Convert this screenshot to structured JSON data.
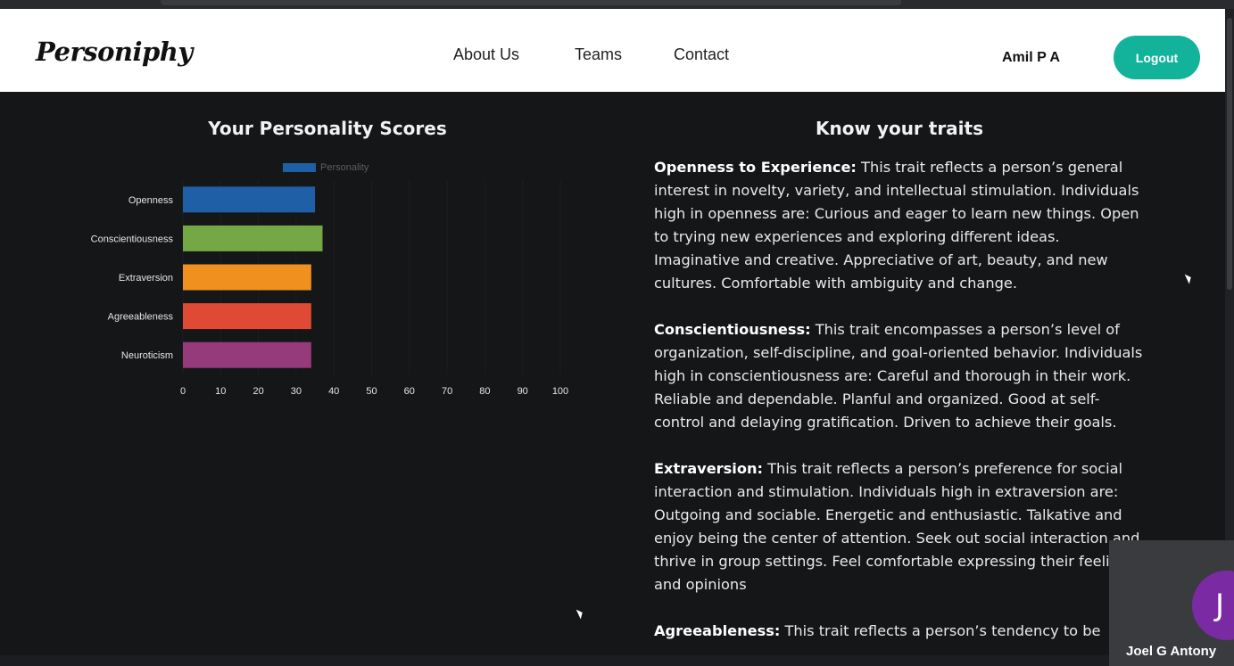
{
  "brand": {
    "logo_text": "Personiphy"
  },
  "nav": {
    "about": "About Us",
    "teams": "Teams",
    "contact": "Contact"
  },
  "user": {
    "name": "Amil P A",
    "logout_label": "Logout"
  },
  "chart_section": {
    "title": "Your Personality Scores"
  },
  "chart_data": {
    "type": "bar",
    "orientation": "horizontal",
    "title": "Your Personality Scores",
    "categories": [
      "Openness",
      "Conscientiousness",
      "Extraversion",
      "Agreeableness",
      "Neuroticism"
    ],
    "series": [
      {
        "name": "Personality",
        "values": [
          35,
          37,
          34,
          34,
          34
        ]
      }
    ],
    "colors": [
      "#1f5fa6",
      "#74a844",
      "#f0901e",
      "#e04a35",
      "#953a7a"
    ],
    "legend_color": "#1f5fa6",
    "xlim": [
      0,
      100
    ],
    "xticks": [
      "0",
      "10",
      "20",
      "30",
      "40",
      "50",
      "60",
      "70",
      "80",
      "90",
      "100"
    ],
    "legend": "top",
    "grid": true
  },
  "traits_section": {
    "title": "Know your traits",
    "items": [
      {
        "name": "Openness to Experience:",
        "text": " This trait reflects a person’s general interest in novelty, variety, and intellectual stimulation. Individuals high in openness are: Curious and eager to learn new things. Open to trying new experiences and exploring different ideas. Imaginative and creative. Appreciative of art, beauty, and new cultures. Comfortable with ambiguity and change."
      },
      {
        "name": "Conscientiousness:",
        "text": " This trait encompasses a person’s level of organization, self-discipline, and goal-oriented behavior. Individuals high in conscientiousness are: Careful and thorough in their work. Reliable and dependable. Planful and organized. Good at self-control and delaying gratification. Driven to achieve their goals."
      },
      {
        "name": "Extraversion:",
        "text": " This trait reflects a person’s preference for social interaction and stimulation. Individuals high in extraversion are: Outgoing and sociable. Energetic and enthusiastic. Talkative and enjoy being the center of attention. Seek out social interaction and thrive in group settings. Feel comfortable expressing their feelings and opinions"
      },
      {
        "name": "Agreeableness:",
        "text": " This trait reflects a person’s tendency to be"
      }
    ]
  },
  "video_tile": {
    "initial": "J",
    "name": "Joel G Antony",
    "avatar_color": "#7a2aa3"
  },
  "colors": {
    "accent": "#12b39a",
    "background": "#151618"
  }
}
